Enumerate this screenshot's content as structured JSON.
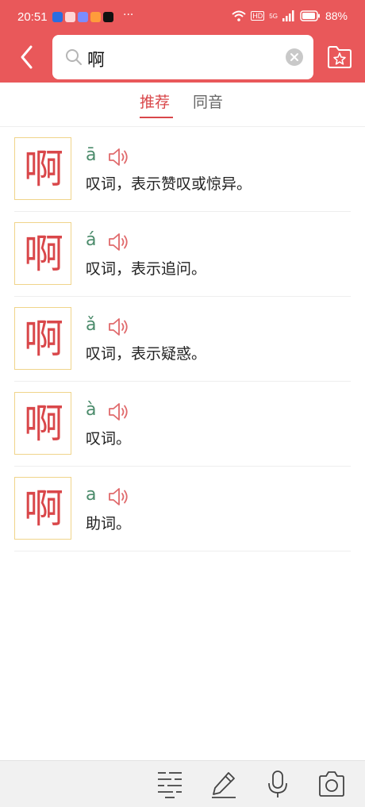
{
  "status": {
    "time": "20:51",
    "more": "···",
    "network_badge": "HD",
    "signal_label": "5G",
    "battery": "88%"
  },
  "search": {
    "query": "啊"
  },
  "tabs": [
    {
      "label": "推荐"
    },
    {
      "label": "同音"
    }
  ],
  "entries": [
    {
      "char": "啊",
      "pinyin": "ā",
      "definition": "叹词，表示赞叹或惊异。"
    },
    {
      "char": "啊",
      "pinyin": "á",
      "definition": "叹词，表示追问。"
    },
    {
      "char": "啊",
      "pinyin": "ǎ",
      "definition": "叹词，表示疑惑。"
    },
    {
      "char": "啊",
      "pinyin": "à",
      "definition": "叹词。"
    },
    {
      "char": "啊",
      "pinyin": "a",
      "definition": "助词。"
    }
  ],
  "icons": {
    "back": "chevron-left-icon",
    "search": "search-icon",
    "clear": "clear-circle-icon",
    "favorites": "star-folder-icon",
    "speaker": "speaker-icon",
    "bottom": [
      "list-icon",
      "pen-icon",
      "mic-icon",
      "camera-icon"
    ]
  },
  "colors": {
    "brand": "#E9585A",
    "accent": "#D9474A",
    "pinyin": "#4B8B6B",
    "char_border": "#F0D48A"
  }
}
